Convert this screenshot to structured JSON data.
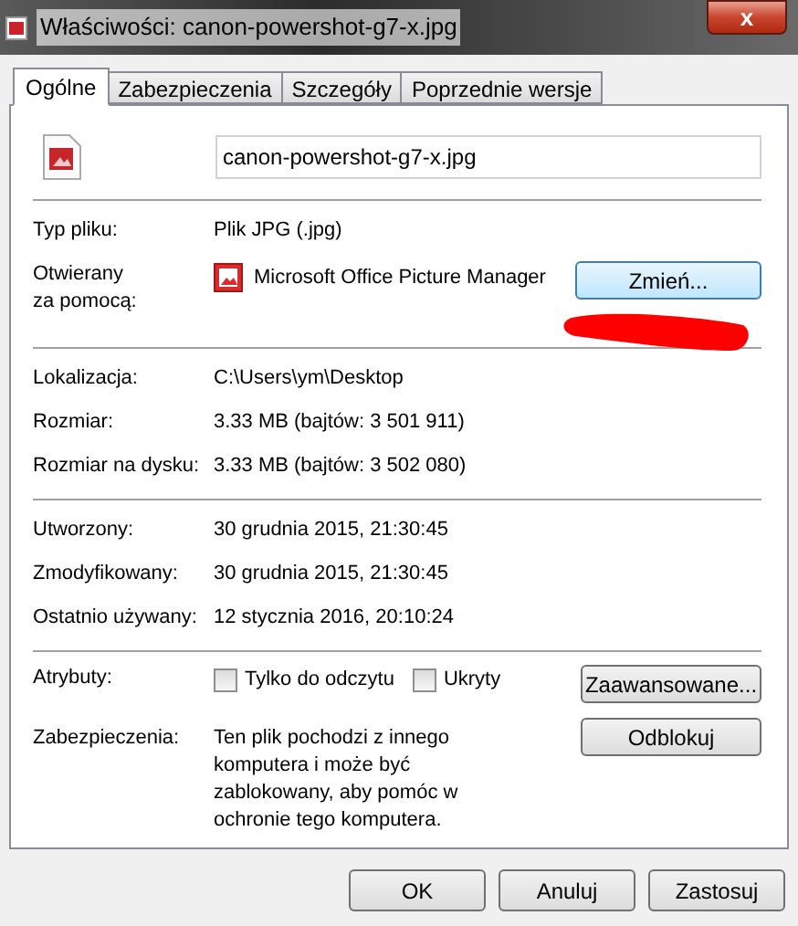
{
  "window": {
    "title": "Właściwości: canon-powershot-g7-x.jpg",
    "close": "x"
  },
  "tabs": [
    {
      "label": "Ogólne",
      "selected": true
    },
    {
      "label": "Zabezpieczenia",
      "selected": false
    },
    {
      "label": "Szczegóły",
      "selected": false
    },
    {
      "label": "Poprzednie wersje",
      "selected": false
    }
  ],
  "file_name": "canon-powershot-g7-x.jpg",
  "sections": [
    [
      {
        "kind": "text",
        "label": "Typ pliku:",
        "value": "Plik JPG (.jpg)"
      },
      {
        "kind": "app",
        "label": "Otwierany\nza pomocą:",
        "value": "Microsoft Office Picture Manager",
        "button": "Zmień..."
      }
    ],
    [
      {
        "kind": "text",
        "label": "Lokalizacja:",
        "value": "C:\\Users\\ym\\Desktop"
      },
      {
        "kind": "text",
        "label": "Rozmiar:",
        "value": "3.33 MB (bajtów: 3 501 911)"
      },
      {
        "kind": "text",
        "label": "Rozmiar na dysku:",
        "value": "3.33 MB (bajtów: 3 502 080)"
      }
    ],
    [
      {
        "kind": "text",
        "label": "Utworzony:",
        "value": "30 grudnia 2015, 21:30:45"
      },
      {
        "kind": "text",
        "label": "Zmodyfikowany:",
        "value": "30 grudnia 2015, 21:30:45"
      },
      {
        "kind": "text",
        "label": "Ostatnio używany:",
        "value": "12 stycznia 2016, 20:10:24"
      }
    ],
    [
      {
        "kind": "attributes",
        "label": "Atrybuty:",
        "checkboxes": [
          {
            "label": "Tylko do odczytu",
            "checked": false
          },
          {
            "label": "Ukryty",
            "checked": false
          }
        ],
        "button": "Zaawansowane..."
      },
      {
        "kind": "security",
        "label": "Zabezpieczenia:",
        "value": "Ten plik pochodzi z innego komputera i może być zablokowany, aby pomóc w ochronie tego komputera.",
        "button": "Odblokuj"
      }
    ]
  ],
  "buttons": [
    "OK",
    "Anuluj",
    "Zastosuj"
  ]
}
